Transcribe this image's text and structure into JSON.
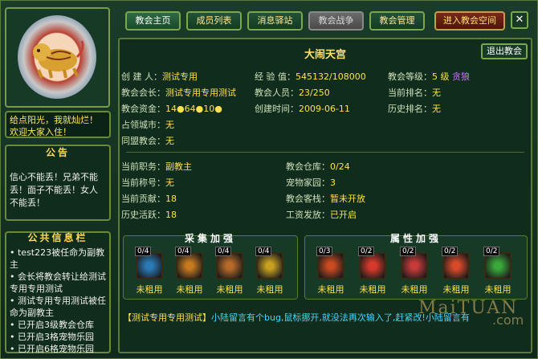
{
  "tabs": [
    {
      "label": "教会主页",
      "state": "active"
    },
    {
      "label": "成员列表",
      "state": "normal"
    },
    {
      "label": "消息驿站",
      "state": "normal"
    },
    {
      "label": "教会战争",
      "state": "disabled"
    },
    {
      "label": "教会管理",
      "state": "normal"
    },
    {
      "label": "进入教会空间",
      "state": "enter"
    }
  ],
  "close_icon": "close-icon",
  "left": {
    "emblem_icon": "tiger-emblem-icon",
    "notice": "给点阳光，我就灿烂！欢迎大家入住！",
    "announcement_title": "公告",
    "announcement_body": "信心不能丢！兄弟不能丢！面子不能丢！女人不能丢！",
    "news_title": "公共信息栏",
    "news_items": [
      "• test223被任命为副教主",
      "• 会长将教会转让给测试专用专用测试",
      "• 测试专用专用测试被任命为副教主",
      "• 已开启3级教会仓库",
      "• 已开启3格宠物乐园",
      "• 已开启6格宠物乐园"
    ]
  },
  "main": {
    "guild_name": "大闹天宫",
    "exit_label": "退出教会",
    "info_left": [
      {
        "label": "创 建 人：",
        "value": "测试专用"
      },
      {
        "label": "教会会长：",
        "value": "测试专用专用测试"
      },
      {
        "label": "教会资金：",
        "value": "14●64●10●"
      },
      {
        "label": "占领城市：",
        "value": "无"
      },
      {
        "label": "同盟教会：",
        "value": "无"
      }
    ],
    "info_mid": [
      {
        "label": "经 验 值：",
        "value": "545132/108000"
      },
      {
        "label": "教会人员：",
        "value": "23/250"
      },
      {
        "label": "创建时间：",
        "value": "2009-06-11"
      }
    ],
    "info_right": [
      {
        "label": "教会等级：",
        "value": "5 级",
        "extra": "贪狼"
      },
      {
        "label": "当前排名：",
        "value": "无"
      },
      {
        "label": "历史排名：",
        "value": "无"
      }
    ],
    "personal_left": [
      {
        "label": "当前职务：",
        "value": "副教主"
      },
      {
        "label": "当前称号：",
        "value": "无"
      },
      {
        "label": "当前贡献：",
        "value": "18"
      },
      {
        "label": "历史活跃：",
        "value": "18"
      }
    ],
    "personal_right": [
      {
        "label": "教会仓库：",
        "value": "0/24"
      },
      {
        "label": "宠物家园：",
        "value": "3"
      },
      {
        "label": "教会客栈：",
        "value": "暂未开放"
      },
      {
        "label": "工资发放：",
        "value": "已开启"
      }
    ],
    "gather_title": "采集加强",
    "gather_skills": [
      {
        "level": "0/4",
        "status": "未租用",
        "icon": "sword-skill-icon",
        "color": "#2a7ab8"
      },
      {
        "level": "0/4",
        "status": "未租用",
        "icon": "herb-skill-icon",
        "color": "#c87a20"
      },
      {
        "level": "0/4",
        "status": "未租用",
        "icon": "axe-skill-icon",
        "color": "#b86a2a"
      },
      {
        "level": "0/4",
        "status": "未租用",
        "icon": "pick-skill-icon",
        "color": "#c8a020"
      }
    ],
    "attr_title": "属性加强",
    "attr_skills": [
      {
        "level": "0/3",
        "status": "未租用",
        "icon": "fire-orb-skill-icon",
        "color": "#c84a20"
      },
      {
        "level": "0/2",
        "status": "未租用",
        "icon": "warrior-skill-icon",
        "color": "#d83a2a"
      },
      {
        "level": "0/2",
        "status": "未租用",
        "icon": "fist-skill-icon",
        "color": "#c83a3a"
      },
      {
        "level": "0/2",
        "status": "未租用",
        "icon": "shield-skill-icon",
        "color": "#d84a2a"
      },
      {
        "level": "0/2",
        "status": "未租用",
        "icon": "green-flame-skill-icon",
        "color": "#3aa83a"
      }
    ],
    "footer_name": "【测试专用专用测试】",
    "footer_text": "小陆留言有个bug,鼠标挪开,就没法再次输入了,赶紧改!小陆留言有"
  },
  "watermark": "MaiTUAN",
  "watermark_suffix": ".com"
}
